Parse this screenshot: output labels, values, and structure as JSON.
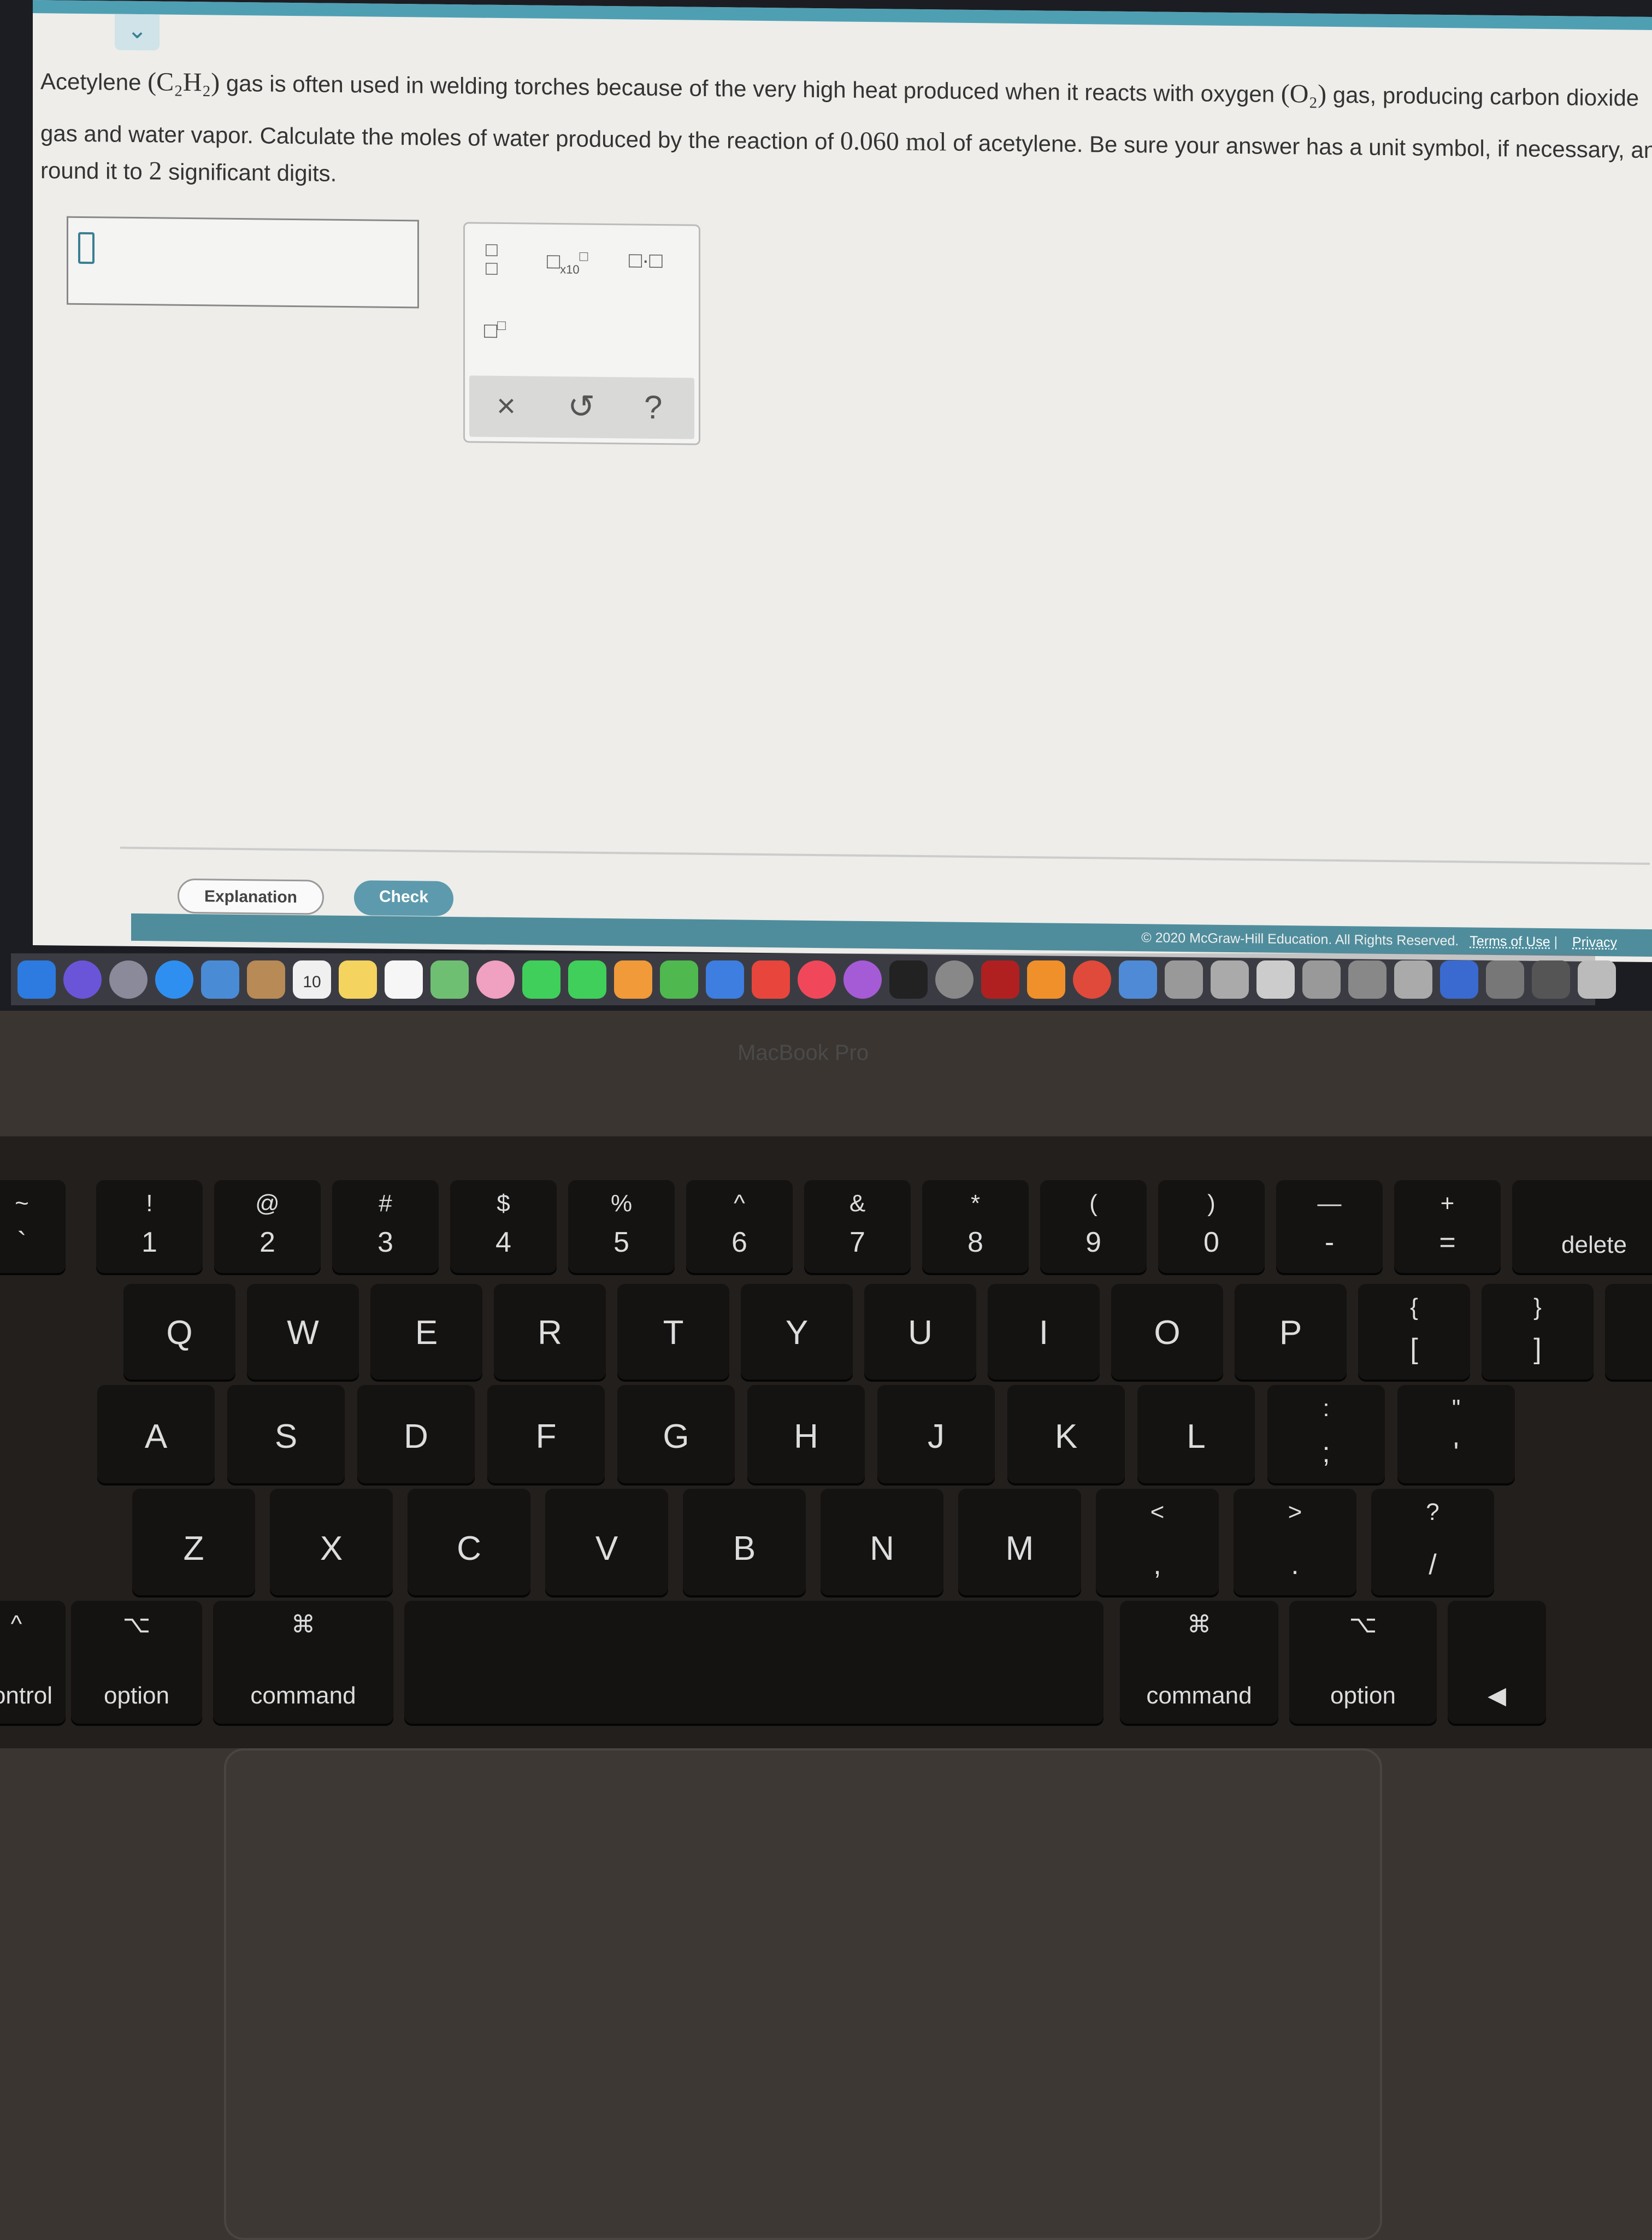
{
  "question": {
    "line1_pre": "Acetylene ",
    "formula1": "(C₂H₂)",
    "line1_mid": " gas is often used in welding torches because of the very high heat produced when it reacts with oxygen ",
    "formula2": "(O₂)",
    "line1_post": " gas, producing carbon dioxide",
    "line2_pre": "gas and water vapor. Calculate the moles of water produced by the reaction of ",
    "amount": "0.060 mol",
    "line2_post": " of acetylene. Be sure your answer has a unit symbol, if necessary, and",
    "line3_pre": "round it to ",
    "sig": "2",
    "line3_post": " significant digits."
  },
  "answer": {
    "value": ""
  },
  "palette": {
    "buttons": [
      "fraction",
      "x10 exponent",
      "multiply-dot",
      "superscript"
    ],
    "x10_label": "x10",
    "clear": "×",
    "undo": "↺",
    "help": "?"
  },
  "actions": {
    "explanation": "Explanation",
    "check": "Check"
  },
  "footer": {
    "copyright": "© 2020 McGraw-Hill Education. All Rights Reserved.",
    "terms": "Terms of Use",
    "sep": "|",
    "privacy": "Privacy"
  },
  "dock": {
    "calendar_day": "10",
    "icons": [
      "finder",
      "siri",
      "launchpad",
      "safari",
      "mail",
      "contacts",
      "calendar",
      "notes",
      "reminders",
      "maps",
      "photos",
      "messages",
      "facetime",
      "pages",
      "numbers",
      "keynote",
      "news",
      "music",
      "podcasts",
      "tv",
      "system-preferences",
      "photo-booth",
      "books",
      "chrome",
      "preview",
      "app",
      "app",
      "app",
      "app",
      "app",
      "app",
      "app",
      "app",
      "app",
      "trash"
    ],
    "colors": [
      "#2d7be0",
      "#6a55d8",
      "#8a8a9a",
      "#2f8ff0",
      "#4a8bd6",
      "#b88a55",
      "#f0f0f0",
      "#f4d35e",
      "#f6f6f6",
      "#6fbf73",
      "#f0a0c0",
      "#3fcf5a",
      "#3fcf5a",
      "#f09a3a",
      "#4fb84f",
      "#3d7ee0",
      "#e8453c",
      "#f0485a",
      "#a65bd6",
      "#222",
      "#888",
      "#b02020",
      "#f0902a",
      "#e04a3a",
      "#4f8ad6",
      "#999",
      "#aaa",
      "#ccc",
      "#999",
      "#888",
      "#aaa",
      "#3a6ad0",
      "#777",
      "#555",
      "#bbb"
    ]
  },
  "device_label": "MacBook Pro",
  "keyboard": {
    "rows": [
      [
        [
          "~",
          "`"
        ],
        [
          "!",
          "1"
        ],
        [
          "@",
          "2"
        ],
        [
          "#",
          "3"
        ],
        [
          "$",
          "4"
        ],
        [
          "%",
          "5"
        ],
        [
          "^",
          "6"
        ],
        [
          "&",
          "7"
        ],
        [
          "*",
          "8"
        ],
        [
          "(",
          "9"
        ],
        [
          ")",
          "0"
        ],
        [
          "—",
          "-"
        ],
        [
          "+",
          "="
        ],
        [
          "",
          "delete"
        ]
      ],
      [
        [
          "",
          "Q"
        ],
        [
          "",
          "W"
        ],
        [
          "",
          "E"
        ],
        [
          "",
          "R"
        ],
        [
          "",
          "T"
        ],
        [
          "",
          "Y"
        ],
        [
          "",
          "U"
        ],
        [
          "",
          "I"
        ],
        [
          "",
          "O"
        ],
        [
          "",
          "P"
        ],
        [
          "{",
          "["
        ],
        [
          "}",
          "]"
        ],
        [
          "|",
          "\\"
        ]
      ],
      [
        [
          "",
          "A"
        ],
        [
          "",
          "S"
        ],
        [
          "",
          "D"
        ],
        [
          "",
          "F"
        ],
        [
          "",
          "G"
        ],
        [
          "",
          "H"
        ],
        [
          "",
          "J"
        ],
        [
          "",
          "K"
        ],
        [
          "",
          "L"
        ],
        [
          ":",
          ";"
        ],
        [
          "\"",
          "'"
        ]
      ],
      [
        [
          "",
          "Z"
        ],
        [
          "",
          "X"
        ],
        [
          "",
          "C"
        ],
        [
          "",
          "V"
        ],
        [
          "",
          "B"
        ],
        [
          "",
          "N"
        ],
        [
          "",
          "M"
        ],
        [
          "<",
          ","
        ],
        [
          ">",
          "."
        ],
        [
          "?",
          "/"
        ]
      ],
      [
        [
          "^",
          "control"
        ],
        [
          "⌥",
          "option"
        ],
        [
          "⌘",
          "command"
        ],
        [
          "",
          ""
        ],
        [
          "⌘",
          "command"
        ],
        [
          "⌥",
          "option"
        ],
        [
          "",
          "◀"
        ]
      ]
    ]
  }
}
